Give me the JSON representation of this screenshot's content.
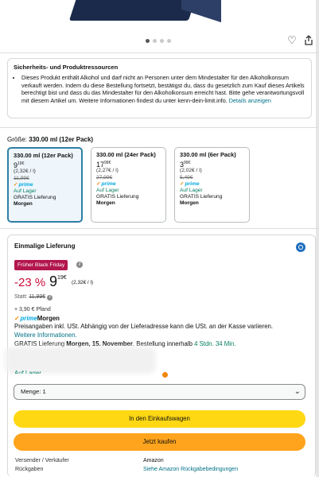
{
  "gallery": {
    "dots": 4,
    "active_dot": 0
  },
  "icons": {
    "favorite": "heart-icon",
    "share": "share-icon"
  },
  "safety": {
    "title": "Sicherheits- und Produktressourcen",
    "text": "Dieses Produkt enthält Alkohol und darf nicht an Personen unter dem Mindestalter für den Alkoholkonsum verkauft werden. Indem du diese Bestellung fortsetzt, bestätigst du, dass du gesetzlich zum Kauf dieses Artikels berechtigt bist und dass du das Mindestalter für den Alkoholkonsum erreicht hast. Bitte gehe verantwortungsvoll mit diesem Artikel um. Weitere Informationen findest du unter kenn-dein-limit.info.",
    "link": "Details anzeigen"
  },
  "size": {
    "label": "Größe:",
    "value": "330.00 ml (12er Pack)",
    "options": [
      {
        "name": "330.00 ml (12er Pack)",
        "price_whole": "9",
        "price_frac": "19€",
        "unit": "(2,32€ / l)",
        "strike": "11,99€",
        "prime": "prime",
        "stock": "Auf Lager",
        "shipping": "GRATIS Lieferung",
        "delivery": "Morgen",
        "selected": true
      },
      {
        "name": "330.00 ml (24er Pack)",
        "price_whole": "17",
        "price_frac": "99€",
        "unit": "(2,27€ / l)",
        "strike": "27,99€",
        "prime": "prime",
        "stock": "Auf Lager",
        "shipping": "GRATIS Lieferung",
        "delivery": "Morgen",
        "selected": false
      },
      {
        "name": "330.00 ml (6er Pack)",
        "price_whole": "3",
        "price_frac": "99€",
        "unit": "(2,02€ / l)",
        "strike": "5,49€",
        "prime": "prime",
        "stock": "Auf Lager",
        "shipping": "GRATIS Lieferung",
        "delivery": "Morgen",
        "selected": false
      }
    ]
  },
  "buybox": {
    "title": "Einmalige Lieferung",
    "deal_badge": "Früher Black Friday",
    "discount": "-23 %",
    "price_whole": "9",
    "price_frac": "19€",
    "price_unit": "(2,32€ / l)",
    "statt_label": "Statt:",
    "statt_value": "11,99€",
    "pfand": "+ 3,90 € Pfand",
    "prime_logo": "prime",
    "prime_delivery": "Morgen",
    "tax_note": "Preisangaben inkl. USt. Abhängig von der Lieferadresse kann die USt. an der Kasse variieren.",
    "more_info": "Weitere Informationen.",
    "delivery_prefix": "GRATIS Lieferung ",
    "delivery_date": "Morgen, 15. November",
    "delivery_middle": ". Bestellung innerhalb ",
    "delivery_window": "4 Stdn. 34 Min.",
    "stock_partial": "Auf Lager",
    "quantity_label": "Menge:",
    "quantity_value": "1",
    "cart_button": "In den Einkaufswagen",
    "buy_button": "Jetzt kaufen",
    "seller_label": "Versender / Verkäufer",
    "seller_value": "Amazon",
    "returns_label": "Rückgaben",
    "returns_value": "Siehe Amazon Rückgabebedingungen"
  },
  "colors": {
    "accent_blue": "#007185",
    "deal_red": "#cc0c39",
    "badge": "#b2164d",
    "cart_yellow": "#ffd814",
    "buy_orange": "#ffa41c",
    "stock_green": "#067d62"
  }
}
